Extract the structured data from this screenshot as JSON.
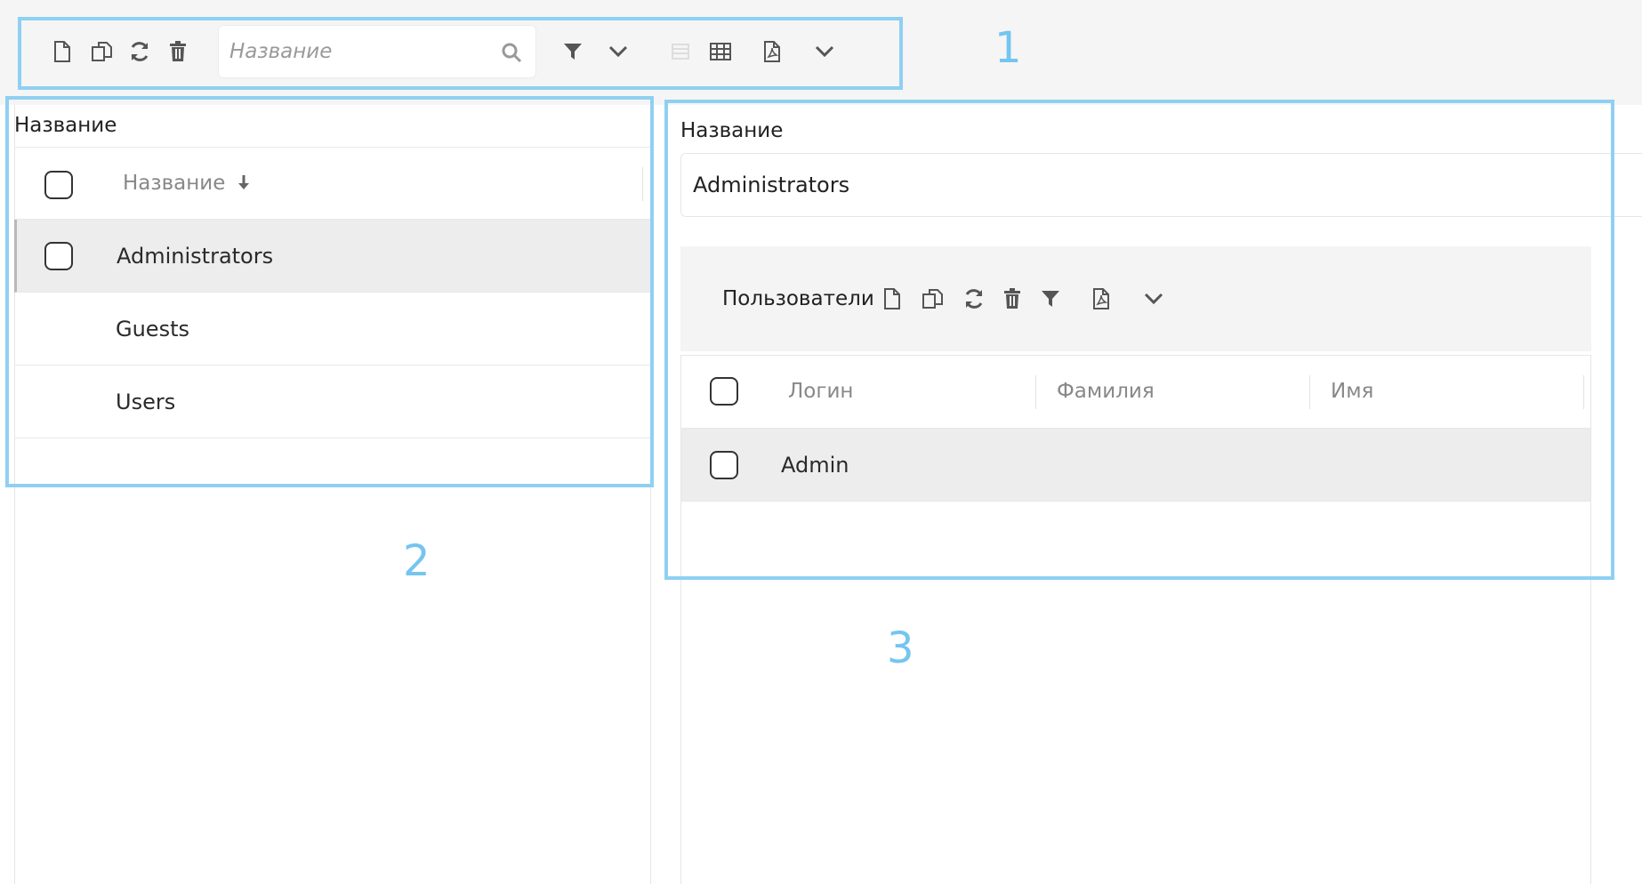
{
  "toolbar": {
    "icons": [
      "new-file-icon",
      "copy-icon",
      "refresh-icon",
      "trash-icon",
      "search-icon",
      "filter-icon",
      "chevron-down-icon",
      "list-icon",
      "table-icon",
      "pdf-icon",
      "chevron-down-icon"
    ],
    "search_placeholder": "Название"
  },
  "left_panel": {
    "title": "Название",
    "column_header": "Название",
    "sort": "descending",
    "rows": [
      {
        "name": "Administrators",
        "selected": true
      },
      {
        "name": "Guests",
        "selected": false
      },
      {
        "name": "Users",
        "selected": false
      }
    ]
  },
  "right_panel": {
    "field_label": "Название",
    "field_value": "Administrators",
    "users": {
      "title": "Пользователи",
      "columns": [
        "Логин",
        "Фамилия",
        "Имя"
      ],
      "rows": [
        {
          "login": "Admin",
          "last_name": "",
          "first_name": "",
          "selected": true
        }
      ]
    }
  },
  "annotations": {
    "one": "1",
    "two": "2",
    "three": "3"
  },
  "colors": {
    "annotation": "#8fd0f2",
    "selected_row": "#ededee",
    "toolbar_bg": "#f5f5f5"
  }
}
